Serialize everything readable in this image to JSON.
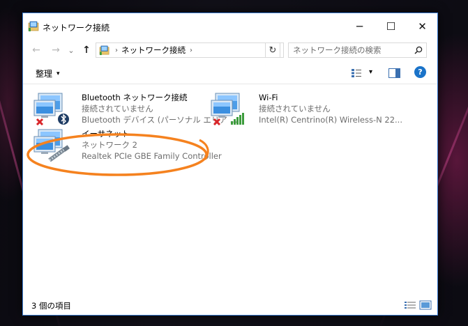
{
  "window": {
    "title": "ネットワーク接続",
    "minimize_glyph": "─",
    "maximize_glyph": "☐",
    "close_glyph": "✕"
  },
  "nav": {
    "back_glyph": "←",
    "forward_glyph": "→",
    "history_glyph": "⌄",
    "up_glyph": "↑",
    "breadcrumb_sep": "›",
    "breadcrumb": "ネットワーク接続",
    "dropdown_glyph": "⌄",
    "refresh_glyph": "↻"
  },
  "search": {
    "placeholder": "ネットワーク接続の検索"
  },
  "toolbar": {
    "organize_label": "整理",
    "organize_caret": "▾",
    "view_caret": "▾",
    "help_glyph": "?"
  },
  "connections": [
    {
      "name": "Bluetooth ネットワーク接続",
      "status": "接続されていません",
      "device": "Bluetooth デバイス (パーソナル エリア ...",
      "icon": "bluetooth-adapter-icon",
      "disconnected": true
    },
    {
      "name": "Wi-Fi",
      "status": "接続されていません",
      "device": "Intel(R) Centrino(R) Wireless-N 22...",
      "icon": "wifi-adapter-icon",
      "disconnected": true
    },
    {
      "name": "イーサネット",
      "status": "ネットワーク 2",
      "device": "Realtek PCIe GBE Family Controller",
      "icon": "ethernet-adapter-icon",
      "disconnected": false
    }
  ],
  "status_bar": {
    "item_count": "3 個の項目"
  },
  "colors": {
    "window_border": "#3a7bd1",
    "highlight": "#f5821f",
    "help_blue": "#1a73c9",
    "error_red": "#d9262a",
    "signal_green": "#3d9c3d"
  }
}
